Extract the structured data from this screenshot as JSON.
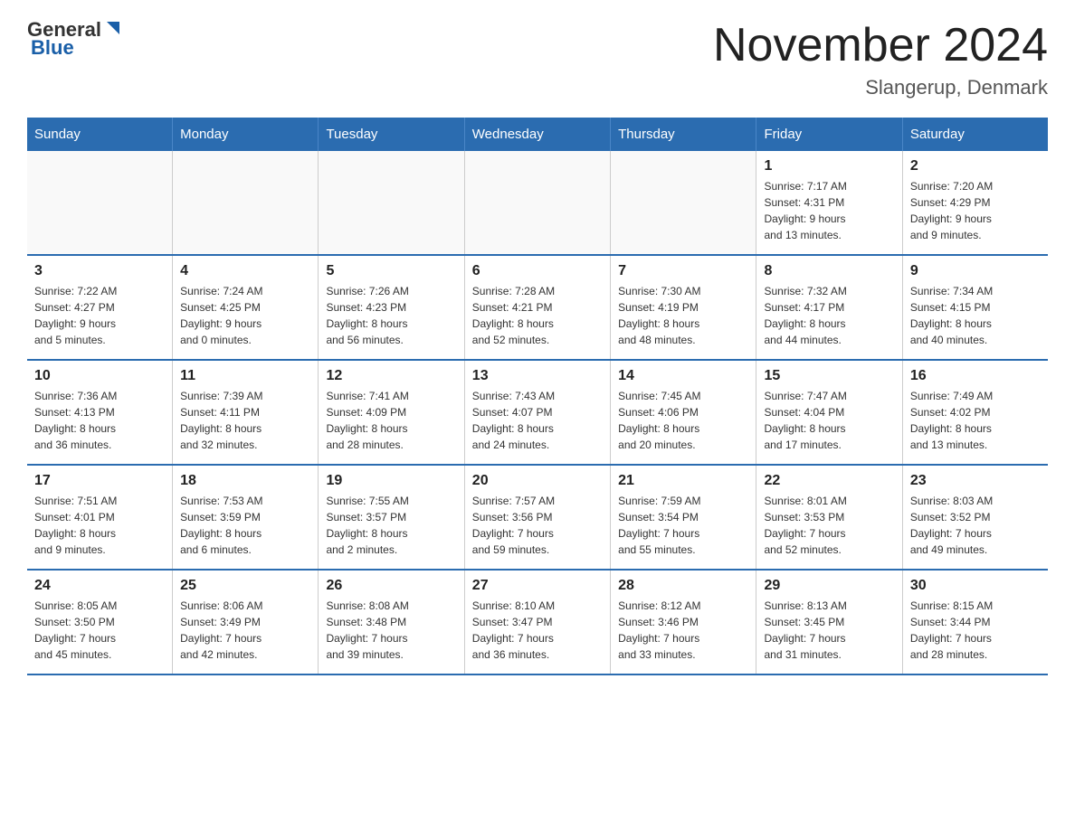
{
  "header": {
    "logo_general": "General",
    "logo_blue": "Blue",
    "title": "November 2024",
    "subtitle": "Slangerup, Denmark"
  },
  "days_of_week": [
    "Sunday",
    "Monday",
    "Tuesday",
    "Wednesday",
    "Thursday",
    "Friday",
    "Saturday"
  ],
  "weeks": [
    [
      {
        "day": "",
        "info": ""
      },
      {
        "day": "",
        "info": ""
      },
      {
        "day": "",
        "info": ""
      },
      {
        "day": "",
        "info": ""
      },
      {
        "day": "",
        "info": ""
      },
      {
        "day": "1",
        "info": "Sunrise: 7:17 AM\nSunset: 4:31 PM\nDaylight: 9 hours\nand 13 minutes."
      },
      {
        "day": "2",
        "info": "Sunrise: 7:20 AM\nSunset: 4:29 PM\nDaylight: 9 hours\nand 9 minutes."
      }
    ],
    [
      {
        "day": "3",
        "info": "Sunrise: 7:22 AM\nSunset: 4:27 PM\nDaylight: 9 hours\nand 5 minutes."
      },
      {
        "day": "4",
        "info": "Sunrise: 7:24 AM\nSunset: 4:25 PM\nDaylight: 9 hours\nand 0 minutes."
      },
      {
        "day": "5",
        "info": "Sunrise: 7:26 AM\nSunset: 4:23 PM\nDaylight: 8 hours\nand 56 minutes."
      },
      {
        "day": "6",
        "info": "Sunrise: 7:28 AM\nSunset: 4:21 PM\nDaylight: 8 hours\nand 52 minutes."
      },
      {
        "day": "7",
        "info": "Sunrise: 7:30 AM\nSunset: 4:19 PM\nDaylight: 8 hours\nand 48 minutes."
      },
      {
        "day": "8",
        "info": "Sunrise: 7:32 AM\nSunset: 4:17 PM\nDaylight: 8 hours\nand 44 minutes."
      },
      {
        "day": "9",
        "info": "Sunrise: 7:34 AM\nSunset: 4:15 PM\nDaylight: 8 hours\nand 40 minutes."
      }
    ],
    [
      {
        "day": "10",
        "info": "Sunrise: 7:36 AM\nSunset: 4:13 PM\nDaylight: 8 hours\nand 36 minutes."
      },
      {
        "day": "11",
        "info": "Sunrise: 7:39 AM\nSunset: 4:11 PM\nDaylight: 8 hours\nand 32 minutes."
      },
      {
        "day": "12",
        "info": "Sunrise: 7:41 AM\nSunset: 4:09 PM\nDaylight: 8 hours\nand 28 minutes."
      },
      {
        "day": "13",
        "info": "Sunrise: 7:43 AM\nSunset: 4:07 PM\nDaylight: 8 hours\nand 24 minutes."
      },
      {
        "day": "14",
        "info": "Sunrise: 7:45 AM\nSunset: 4:06 PM\nDaylight: 8 hours\nand 20 minutes."
      },
      {
        "day": "15",
        "info": "Sunrise: 7:47 AM\nSunset: 4:04 PM\nDaylight: 8 hours\nand 17 minutes."
      },
      {
        "day": "16",
        "info": "Sunrise: 7:49 AM\nSunset: 4:02 PM\nDaylight: 8 hours\nand 13 minutes."
      }
    ],
    [
      {
        "day": "17",
        "info": "Sunrise: 7:51 AM\nSunset: 4:01 PM\nDaylight: 8 hours\nand 9 minutes."
      },
      {
        "day": "18",
        "info": "Sunrise: 7:53 AM\nSunset: 3:59 PM\nDaylight: 8 hours\nand 6 minutes."
      },
      {
        "day": "19",
        "info": "Sunrise: 7:55 AM\nSunset: 3:57 PM\nDaylight: 8 hours\nand 2 minutes."
      },
      {
        "day": "20",
        "info": "Sunrise: 7:57 AM\nSunset: 3:56 PM\nDaylight: 7 hours\nand 59 minutes."
      },
      {
        "day": "21",
        "info": "Sunrise: 7:59 AM\nSunset: 3:54 PM\nDaylight: 7 hours\nand 55 minutes."
      },
      {
        "day": "22",
        "info": "Sunrise: 8:01 AM\nSunset: 3:53 PM\nDaylight: 7 hours\nand 52 minutes."
      },
      {
        "day": "23",
        "info": "Sunrise: 8:03 AM\nSunset: 3:52 PM\nDaylight: 7 hours\nand 49 minutes."
      }
    ],
    [
      {
        "day": "24",
        "info": "Sunrise: 8:05 AM\nSunset: 3:50 PM\nDaylight: 7 hours\nand 45 minutes."
      },
      {
        "day": "25",
        "info": "Sunrise: 8:06 AM\nSunset: 3:49 PM\nDaylight: 7 hours\nand 42 minutes."
      },
      {
        "day": "26",
        "info": "Sunrise: 8:08 AM\nSunset: 3:48 PM\nDaylight: 7 hours\nand 39 minutes."
      },
      {
        "day": "27",
        "info": "Sunrise: 8:10 AM\nSunset: 3:47 PM\nDaylight: 7 hours\nand 36 minutes."
      },
      {
        "day": "28",
        "info": "Sunrise: 8:12 AM\nSunset: 3:46 PM\nDaylight: 7 hours\nand 33 minutes."
      },
      {
        "day": "29",
        "info": "Sunrise: 8:13 AM\nSunset: 3:45 PM\nDaylight: 7 hours\nand 31 minutes."
      },
      {
        "day": "30",
        "info": "Sunrise: 8:15 AM\nSunset: 3:44 PM\nDaylight: 7 hours\nand 28 minutes."
      }
    ]
  ]
}
